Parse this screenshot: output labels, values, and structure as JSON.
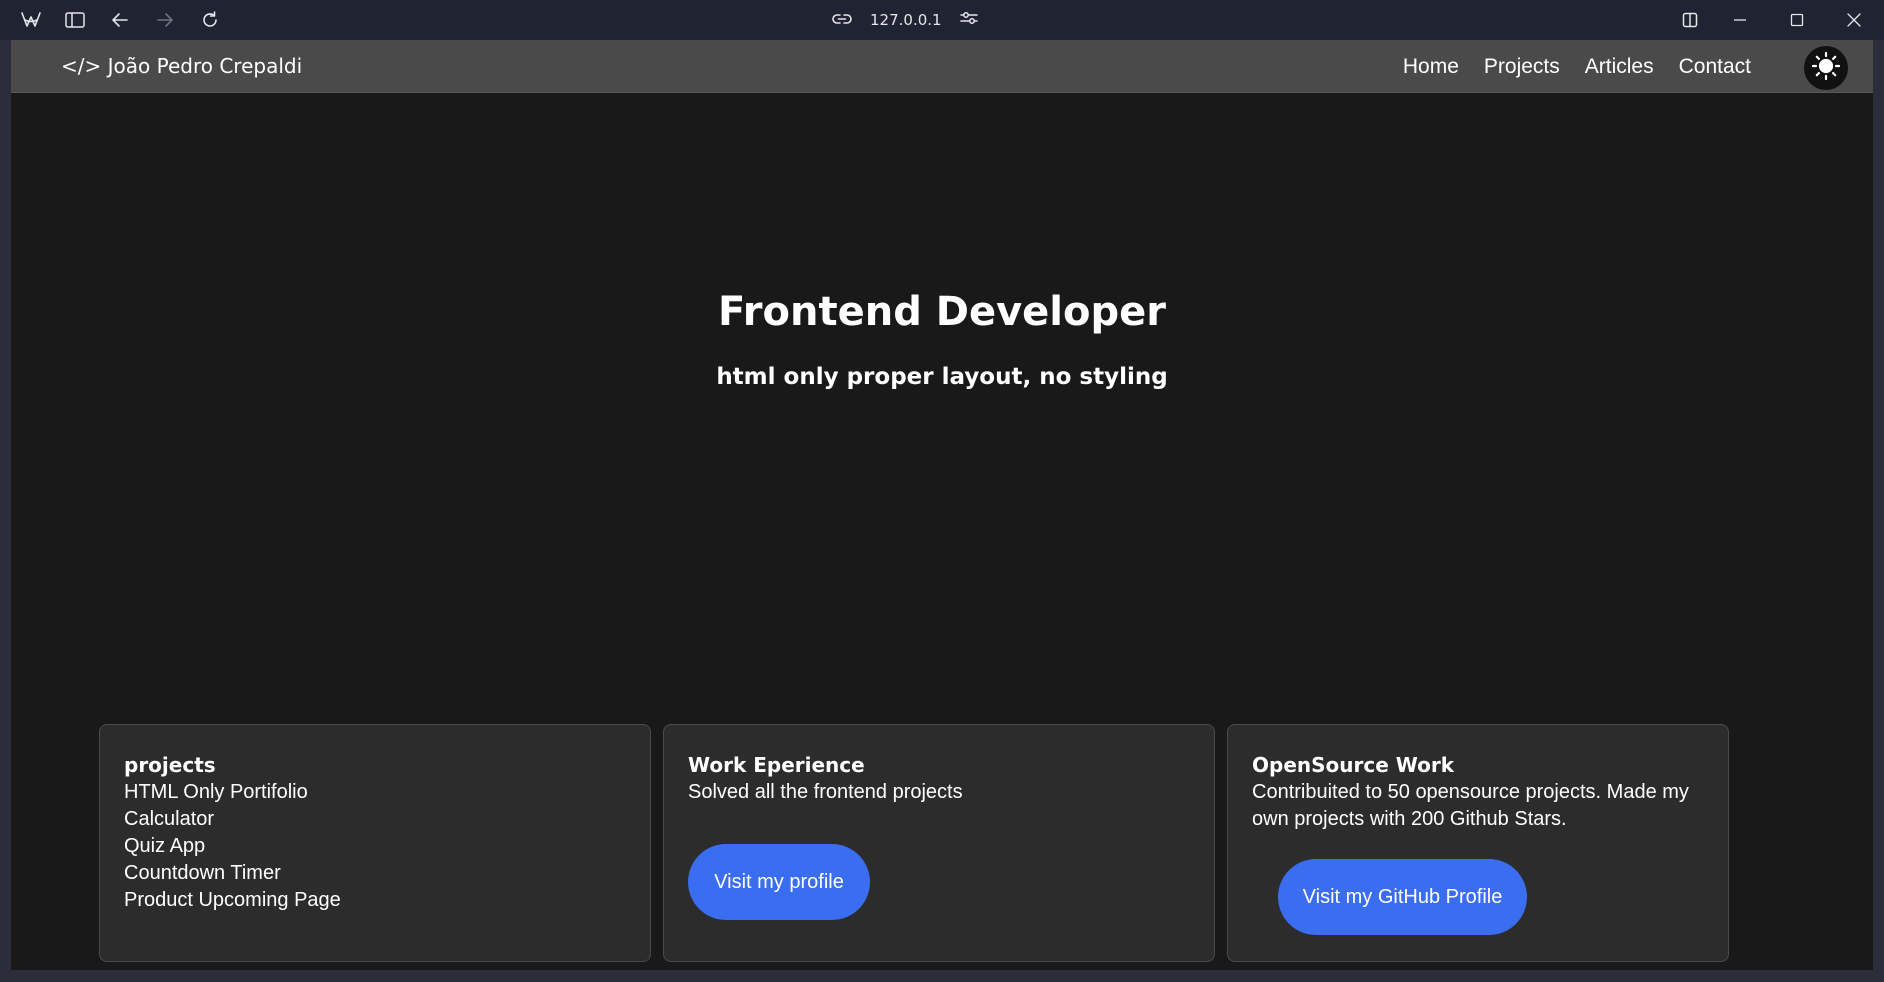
{
  "browser": {
    "url": "127.0.0.1",
    "icons": [
      "app-logo-icon",
      "sidebar-toggle-icon",
      "back-icon",
      "forward-icon",
      "reload-icon",
      "link-icon",
      "site-settings-icon",
      "split-view-icon",
      "minimize-icon",
      "maximize-icon",
      "close-icon"
    ]
  },
  "navbar": {
    "brand": "</> João Pedro Crepaldi",
    "links": [
      "Home",
      "Projects",
      "Articles",
      "Contact"
    ],
    "theme_icon": "sun-icon"
  },
  "hero": {
    "title": "Frontend Developer",
    "subtitle": "html only proper layout, no styling"
  },
  "cards": {
    "projects": {
      "title": "projects",
      "items": [
        "HTML Only Portifolio",
        "Calculator",
        "Quiz App",
        "Countdown Timer",
        "Product Upcoming Page"
      ]
    },
    "work": {
      "title": "Work Eperience",
      "text": "Solved all the frontend projects",
      "button": "Visit my profile"
    },
    "opensource": {
      "title": "OpenSource Work",
      "text_line1": "Contribuited to 50 opensource projects. Made my",
      "text_line2": "own projects with 200 Github Stars.",
      "button": "Visit my GitHub Profile"
    }
  },
  "colors": {
    "page_bg": "#19191a",
    "navbar_bg": "#4a4a4a",
    "card_bg": "#2c2c2c",
    "button_bg": "#3a6df0"
  }
}
